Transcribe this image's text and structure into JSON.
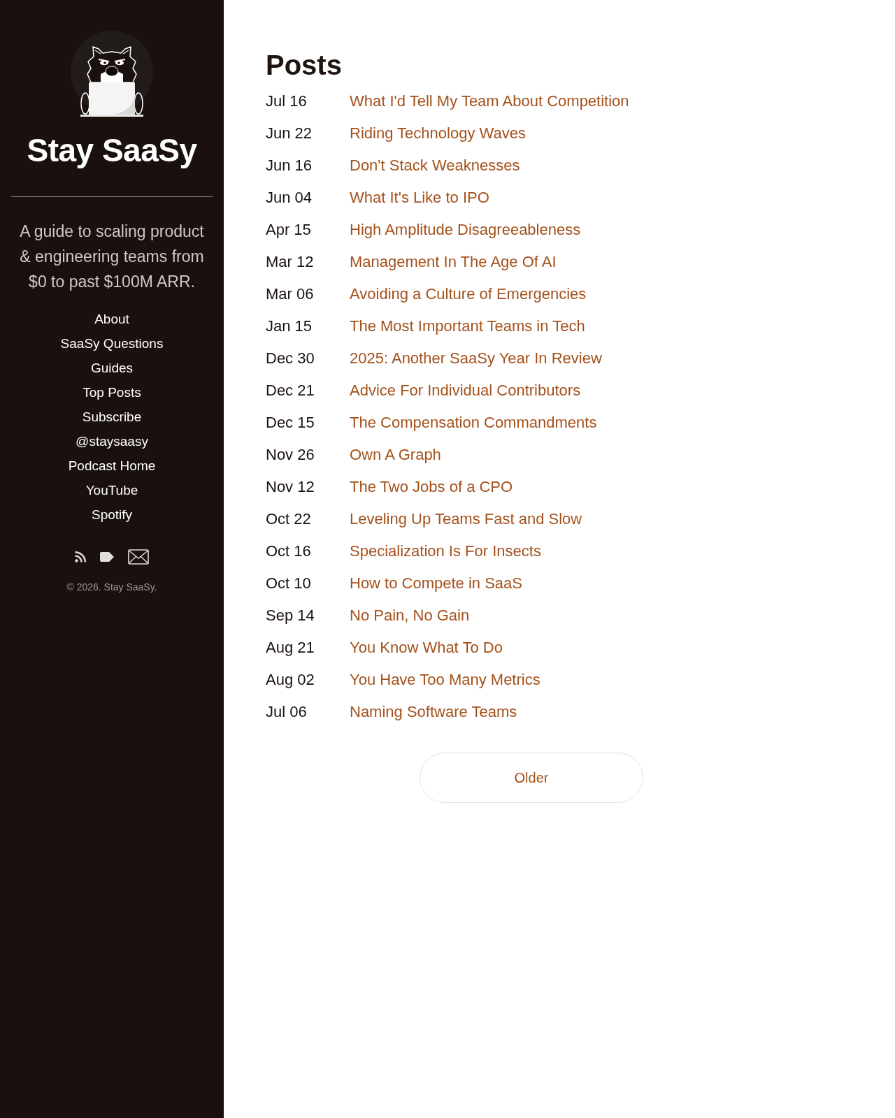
{
  "sidebar": {
    "site_title": "Stay SaaSy",
    "tagline": "A guide to scaling product & engineering teams from $0 to past $100M ARR.",
    "nav": [
      "About",
      "SaaSy Questions",
      "Guides",
      "Top Posts",
      "Subscribe",
      "@staysaasy",
      "Podcast Home",
      "YouTube",
      "Spotify"
    ],
    "copyright": "© 2026. Stay SaaSy."
  },
  "main": {
    "heading": "Posts",
    "posts": [
      {
        "date": "Jul 16",
        "title": "What I'd Tell My Team About Competition"
      },
      {
        "date": "Jun 22",
        "title": "Riding Technology Waves"
      },
      {
        "date": "Jun 16",
        "title": "Don't Stack Weaknesses"
      },
      {
        "date": "Jun 04",
        "title": "What It's Like to IPO"
      },
      {
        "date": "Apr 15",
        "title": "High Amplitude Disagreeableness"
      },
      {
        "date": "Mar 12",
        "title": "Management In The Age Of AI"
      },
      {
        "date": "Mar 06",
        "title": "Avoiding a Culture of Emergencies"
      },
      {
        "date": "Jan 15",
        "title": "The Most Important Teams in Tech"
      },
      {
        "date": "Dec 30",
        "title": "2025: Another SaaSy Year In Review"
      },
      {
        "date": "Dec 21",
        "title": "Advice For Individual Contributors"
      },
      {
        "date": "Dec 15",
        "title": "The Compensation Commandments"
      },
      {
        "date": "Nov 26",
        "title": "Own A Graph"
      },
      {
        "date": "Nov 12",
        "title": "The Two Jobs of a CPO"
      },
      {
        "date": "Oct 22",
        "title": "Leveling Up Teams Fast and Slow"
      },
      {
        "date": "Oct 16",
        "title": "Specialization Is For Insects"
      },
      {
        "date": "Oct 10",
        "title": "How to Compete in SaaS"
      },
      {
        "date": "Sep 14",
        "title": "No Pain, No Gain"
      },
      {
        "date": "Aug 21",
        "title": "You Know What To Do"
      },
      {
        "date": "Aug 02",
        "title": "You Have Too Many Metrics"
      },
      {
        "date": "Jul 06",
        "title": "Naming Software Teams"
      }
    ],
    "older_button": "Older"
  }
}
